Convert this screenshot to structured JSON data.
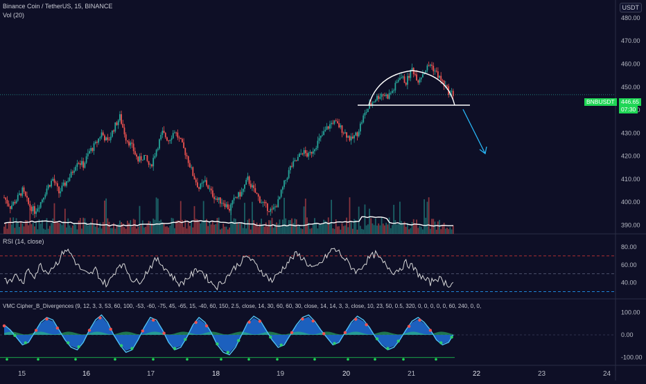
{
  "header": {
    "symbol_line": "Binance Coin / TetherUS, 15, BINANCE",
    "vol_line": "Vol (20)",
    "rsi_line": "RSI (14, close)",
    "vmc_line": "VMC Cipher_B_Divergences (9, 12, 3, 3, 53, 60, 100, -53, -60, -75, 45, -65, 15, -40, 60, 150, 2.5, close, 14, 30, 60, 60, 30, close, 14, 14, 3, 3, close, 10, 23, 50, 0.5, 320, 0, 0, 0, 0, 0, 60, 240, 0, 0, 240)"
  },
  "currency_button": "USDT",
  "price_badge": {
    "ticker": "BNBUSDT",
    "price": "446.65",
    "countdown": "07:30"
  },
  "chart_data": [
    {
      "type": "line",
      "panel": "price",
      "series": [
        {
          "name": "BNBUSDT",
          "values": [
            402,
            398,
            401,
            405,
            399,
            396,
            400,
            406,
            410,
            404,
            408,
            412,
            418,
            416,
            422,
            425,
            430,
            426,
            432,
            437,
            428,
            424,
            418,
            420,
            415,
            423,
            430,
            427,
            431,
            426,
            420,
            412,
            406,
            409,
            404,
            401,
            400,
            397,
            402,
            404,
            410,
            405,
            401,
            398,
            396,
            400,
            408,
            415,
            418,
            422,
            420,
            424,
            428,
            432,
            435,
            433,
            430,
            427,
            430,
            437,
            442,
            445,
            447,
            446,
            449,
            455,
            452,
            458,
            453,
            457,
            460,
            456,
            452,
            448,
            446.65
          ]
        }
      ],
      "x_ticks": [
        "15",
        "16",
        "17",
        "18",
        "19",
        "20",
        "21",
        "22",
        "23",
        "24"
      ],
      "y_ticks": [
        "480.00",
        "470.00",
        "460.00",
        "450.00",
        "440.00",
        "430.00",
        "420.00",
        "410.00",
        "400.00",
        "390.00"
      ],
      "ylim": [
        388,
        486
      ],
      "annotations": [
        "rounded top arc",
        "neckline",
        "down arrow"
      ]
    },
    {
      "type": "line",
      "panel": "rsi",
      "series": [
        {
          "name": "RSI",
          "values": [
            45,
            40,
            50,
            38,
            55,
            48,
            60,
            52,
            58,
            65,
            78,
            72,
            60,
            52,
            48,
            55,
            42,
            38,
            50,
            62,
            56,
            44,
            40,
            48,
            58,
            66,
            60,
            52,
            44,
            38,
            45,
            50,
            56,
            48,
            40,
            36,
            42,
            50,
            58,
            64,
            70,
            62,
            55,
            48,
            42,
            50,
            58,
            66,
            72,
            68,
            60,
            55,
            62,
            70,
            78,
            74,
            66,
            58,
            52,
            60,
            68,
            72,
            64,
            58,
            52,
            56,
            62,
            58,
            50,
            44,
            40,
            46,
            42,
            38,
            40
          ]
        }
      ],
      "y_ticks": [
        "80.00",
        "60.00",
        "40.00"
      ],
      "ylim": [
        25,
        90
      ],
      "levels": [
        70,
        50,
        30
      ]
    },
    {
      "type": "area",
      "panel": "vmc",
      "series": [
        {
          "name": "WaveTrend",
          "values": [
            40,
            20,
            -10,
            -40,
            -30,
            10,
            50,
            70,
            60,
            20,
            -20,
            -50,
            -60,
            -30,
            20,
            60,
            80,
            50,
            0,
            -40,
            -70,
            -60,
            -20,
            30,
            70,
            60,
            20,
            -30,
            -60,
            -50,
            -10,
            40,
            70,
            50,
            10,
            -40,
            -70,
            -80,
            -50,
            0,
            50,
            75,
            60,
            20,
            -20,
            -50,
            -40,
            0,
            40,
            70,
            80,
            55,
            20,
            -10,
            -40,
            -30,
            10,
            50,
            75,
            60,
            30,
            -10,
            -40,
            -60,
            -50,
            -20,
            20,
            55,
            70,
            50,
            20,
            -20,
            -40,
            -30,
            10
          ]
        }
      ],
      "y_ticks": [
        "100.00",
        "0.00",
        "-100.00"
      ],
      "ylim": [
        -110,
        110
      ]
    }
  ],
  "colors": {
    "bg": "#0e0f26",
    "bull": "#26a69a",
    "bear": "#ef5350",
    "rsi_line": "#d9d9d9",
    "rsi_upper": "#e53935",
    "rsi_lower": "#2196f3",
    "wave": "#1e6fd9",
    "wave_line": "#4fc3f7",
    "badge": "#1fd655",
    "arrow": "#29b6f6",
    "pattern": "#ffffff"
  }
}
